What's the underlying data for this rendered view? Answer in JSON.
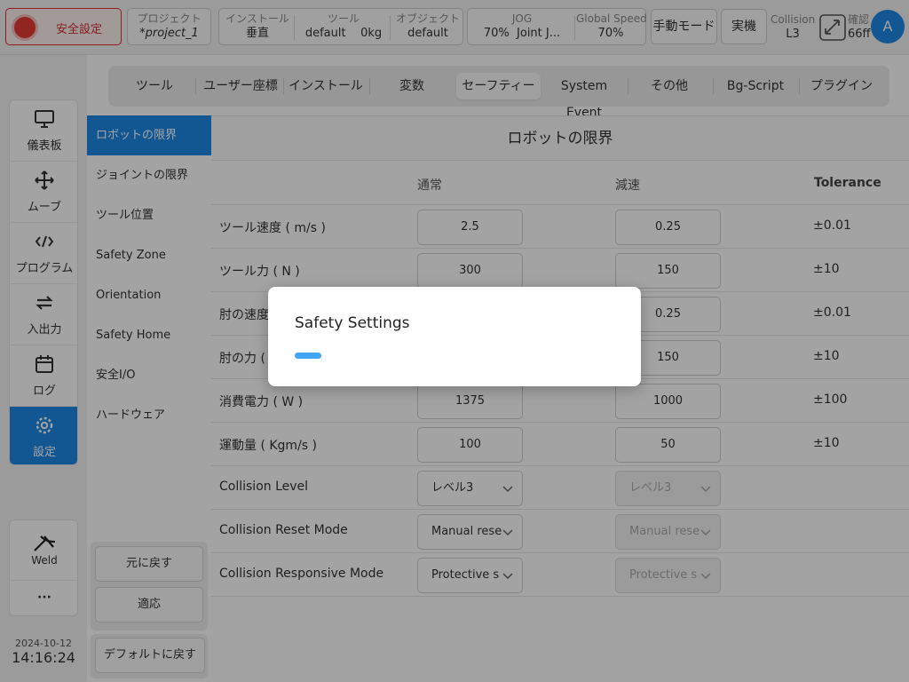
{
  "topbar": {
    "safety_label": "安全設定",
    "project": {
      "caption": "プロジェクト",
      "value": "*project_1"
    },
    "install": {
      "caption": "インストール",
      "value": "垂直"
    },
    "tool": {
      "caption": "ツール",
      "value1": "default",
      "value2": "0kg"
    },
    "object": {
      "caption": "オブジェクト",
      "value": "default"
    },
    "jog": {
      "caption": "JOG",
      "value1": "70%",
      "value2": "Joint J..."
    },
    "global_speed": {
      "caption": "Global Speed",
      "value": "70%"
    },
    "manual_mode": "手動モード",
    "real_machine": "実機",
    "collision": {
      "caption": "Collision",
      "value": "L3"
    },
    "confirm": {
      "caption": "確認",
      "value": "66ff"
    },
    "avatar": "A"
  },
  "leftnav": {
    "items": [
      {
        "label": "儀表板",
        "icon": "monitor-icon"
      },
      {
        "label": "ムーブ",
        "icon": "move-arrows-icon"
      },
      {
        "label": "プログラム",
        "icon": "code-icon"
      },
      {
        "label": "入出力",
        "icon": "io-arrows-icon"
      },
      {
        "label": "ログ",
        "icon": "calendar-icon"
      },
      {
        "label": "設定",
        "icon": "gear-icon"
      }
    ],
    "weld": "Weld",
    "more": "···",
    "date": "2024-10-12",
    "time": "14:16:24"
  },
  "tabs": [
    "ツール",
    "ユーザー座標",
    "インストール",
    "変数",
    "セーフティー",
    "System Event",
    "その他",
    "Bg-Script",
    "プラグイン"
  ],
  "subnav": [
    "ロボットの限界",
    "ジョイントの限界",
    "ツール位置",
    "Safety Zone",
    "Orientation",
    "Safety Home",
    "安全I/O",
    "ハードウェア"
  ],
  "actions": {
    "revert": "元に戻す",
    "apply": "適応",
    "default": "デフォルトに戻す"
  },
  "main": {
    "title": "ロボットの限界",
    "headers": {
      "normal": "通常",
      "reduced": "減速",
      "tolerance": "Tolerance"
    },
    "rows": [
      {
        "label": "ツール速度 ( m/s )",
        "normal": "2.5",
        "reduced": "0.25",
        "tol": "±0.01"
      },
      {
        "label": "ツール力 ( N )",
        "normal": "300",
        "reduced": "150",
        "tol": "±10"
      },
      {
        "label": "肘の速度",
        "normal": "",
        "reduced": "0.25",
        "tol": "±0.01"
      },
      {
        "label": "肘の力 (",
        "normal": "",
        "reduced": "150",
        "tol": "±10"
      },
      {
        "label": "消費電力 ( W )",
        "normal": "1375",
        "reduced": "1000",
        "tol": "±100"
      },
      {
        "label": "運動量 ( Kgm/s )",
        "normal": "100",
        "reduced": "50",
        "tol": "±10"
      }
    ],
    "selects": [
      {
        "label": "Collision Level",
        "normal": "レベル3",
        "reduced": "レベル3"
      },
      {
        "label": "Collision Reset Mode",
        "normal": "Manual rese",
        "reduced": "Manual rese"
      },
      {
        "label": "Collision Responsive Mode",
        "normal": "Protective s",
        "reduced": "Protective s"
      }
    ]
  },
  "modal": {
    "title": "Safety Settings",
    "progress": 0.07
  },
  "colors": {
    "accent": "#1e88e5",
    "danger": "#e53935",
    "progress": "#42a5f5"
  }
}
